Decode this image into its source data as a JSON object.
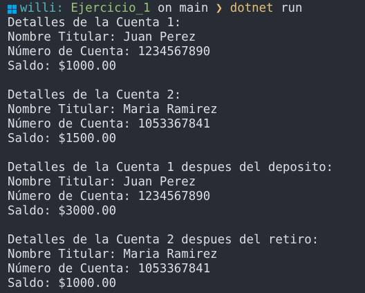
{
  "prompt": {
    "icon": "windows-logo-icon",
    "user": "willi:",
    "folder": "Ejercicio_1",
    "on_text": "on",
    "branch": "main",
    "arrow": "❯",
    "command": "dotnet",
    "argument": "run"
  },
  "output": {
    "line1": "Detalles de la Cuenta 1:",
    "line2": "Nombre Titular: Juan Perez",
    "line3": "Número de Cuenta: 1234567890",
    "line4": "Saldo: $1000.00",
    "line5": "Detalles de la Cuenta 2:",
    "line6": "Nombre Titular: Maria Ramirez",
    "line7": "Número de Cuenta: 1053367841",
    "line8": "Saldo: $1500.00",
    "line9": "Detalles de la Cuenta 1 despues del deposito:",
    "line10": "Nombre Titular: Juan Perez",
    "line11": "Número de Cuenta: 1234567890",
    "line12": "Saldo: $3000.00",
    "line13": "Detalles de la Cuenta 2 despues del retiro:",
    "line14": "Nombre Titular: Maria Ramirez",
    "line15": "Número de Cuenta: 1053367841",
    "line16": "Saldo: $1000.00"
  },
  "colors": {
    "background": "#282c34",
    "text": "#dcdfe4",
    "user": "#56b6c2",
    "folder": "#98c379",
    "command": "#e5c07b",
    "icon": "#00a4ef"
  }
}
